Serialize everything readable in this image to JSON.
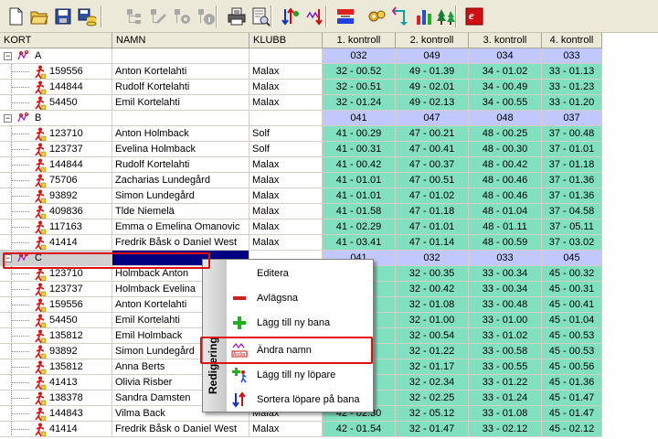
{
  "toolbar": {
    "buttons": [
      "new-icon",
      "open-icon",
      "save-icon",
      "save-db-icon",
      "tree-expand-icon",
      "tree-edit-icon",
      "tree-config-icon",
      "tree-info-icon",
      "print-icon",
      "print-preview-icon",
      "sort-runners-icon",
      "sort-controls-icon",
      "bank-transfer-icon",
      "gears-icon",
      "swap-icon",
      "bar-chart-icon",
      "trees-icon",
      "emit-icon"
    ],
    "emit_letter": "e"
  },
  "grid": {
    "columns": [
      "KORT",
      "NAMN",
      "KLUBB",
      "1. kontroll",
      "2. kontroll",
      "3. kontroll",
      "4. kontroll"
    ],
    "rows": [
      {
        "type": "group",
        "kort": "A",
        "controls": [
          "032",
          "049",
          "034",
          "033"
        ]
      },
      {
        "type": "runner",
        "kort": "159556",
        "namn": "Anton Kortelahti",
        "klubb": "Malax",
        "controls": [
          "32 - 00.52",
          "49 - 01.39",
          "34 - 01.02",
          "33 - 01.13"
        ]
      },
      {
        "type": "runner",
        "kort": "144844",
        "namn": "Rudolf Kortelahti",
        "klubb": "Malax",
        "controls": [
          "32 - 00.51",
          "49 - 02.01",
          "34 - 00.49",
          "33 - 01.23"
        ]
      },
      {
        "type": "runner",
        "kort": "54450",
        "namn": "Emil Kortelahti",
        "klubb": "Malax",
        "controls": [
          "32 - 01.24",
          "49 - 02.13",
          "34 - 00.55",
          "33 - 01.20"
        ]
      },
      {
        "type": "group",
        "kort": "B",
        "controls": [
          "041",
          "047",
          "048",
          "037"
        ]
      },
      {
        "type": "runner",
        "kort": "123710",
        "namn": "Anton Holmback",
        "klubb": "Solf",
        "controls": [
          "41 - 00.29",
          "47 - 00.21",
          "48 - 00.25",
          "37 - 00.48"
        ]
      },
      {
        "type": "runner",
        "kort": "123737",
        "namn": "Evelina Holmback",
        "klubb": "Solf",
        "controls": [
          "41 - 00.31",
          "47 - 00.41",
          "48 - 00.30",
          "37 - 01.01"
        ]
      },
      {
        "type": "runner",
        "kort": "144844",
        "namn": "Rudolf Kortelahti",
        "klubb": "Malax",
        "controls": [
          "41 - 00.42",
          "47 - 00.37",
          "48 - 00.42",
          "37 - 01.18"
        ]
      },
      {
        "type": "runner",
        "kort": "75706",
        "namn": "Zacharias Lundegård",
        "klubb": "Malax",
        "controls": [
          "41 - 01.01",
          "47 - 00.51",
          "48 - 00.46",
          "37 - 01.36"
        ]
      },
      {
        "type": "runner",
        "kort": "93892",
        "namn": "Simon Lundegård",
        "klubb": "Malax",
        "controls": [
          "41 - 01.01",
          "47 - 01.02",
          "48 - 00.46",
          "37 - 01.36"
        ]
      },
      {
        "type": "runner",
        "kort": "409836",
        "namn": "Tlde Niemelä",
        "klubb": "Malax",
        "controls": [
          "41 - 01.58",
          "47 - 01.18",
          "48 - 01.04",
          "37 - 04.58"
        ]
      },
      {
        "type": "runner",
        "kort": "117163",
        "namn": "Emma o Emelina Omanovic",
        "klubb": "Malax",
        "controls": [
          "41 - 02.29",
          "47 - 01.01",
          "48 - 01.11",
          "37 - 05.11"
        ]
      },
      {
        "type": "runner",
        "kort": "41414",
        "namn": "Fredrik Båsk o Daniel West",
        "klubb": "Malax",
        "controls": [
          "41 - 03.41",
          "47 - 01.14",
          "48 - 00.59",
          "37 - 03.02"
        ]
      },
      {
        "type": "group-selected",
        "kort": "C",
        "controls": [
          "041",
          "032",
          "033",
          "045"
        ]
      },
      {
        "type": "runner",
        "kort": "123710",
        "namn": "Holmback Anton",
        "klubb": "",
        "controls": [
          "",
          "32 - 00.35",
          "33 - 00.34",
          "45 - 00.32"
        ]
      },
      {
        "type": "runner",
        "kort": "123737",
        "namn": "Holmback Evelina",
        "klubb": "",
        "controls": [
          "",
          "32 - 00.42",
          "33 - 00.34",
          "45 - 00.31"
        ]
      },
      {
        "type": "runner",
        "kort": "159556",
        "namn": "Anton Kortelahti",
        "klubb": "",
        "controls": [
          "",
          "32 - 01.08",
          "33 - 00.48",
          "45 - 00.41"
        ]
      },
      {
        "type": "runner",
        "kort": "54450",
        "namn": "Emil Kortelahti",
        "klubb": "",
        "controls": [
          "",
          "32 - 01.00",
          "33 - 01.00",
          "45 - 01.04"
        ]
      },
      {
        "type": "runner",
        "kort": "135812",
        "namn": "Emil Holmback",
        "klubb": "",
        "controls": [
          "",
          "32 - 00.54",
          "33 - 01.02",
          "45 - 00.53"
        ]
      },
      {
        "type": "runner",
        "kort": "93892",
        "namn": "Simon Lundegård",
        "klubb": "",
        "controls": [
          "",
          "32 - 01.22",
          "33 - 00.58",
          "45 - 00.53"
        ]
      },
      {
        "type": "runner",
        "kort": "135812",
        "namn": "Anna Berts",
        "klubb": "",
        "controls": [
          "",
          "32 - 01.17",
          "33 - 00.55",
          "45 - 00.56"
        ]
      },
      {
        "type": "runner",
        "kort": "41413",
        "namn": "Olivia Risber",
        "klubb": "",
        "controls": [
          "",
          "32 - 02.34",
          "33 - 01.22",
          "45 - 01.36"
        ]
      },
      {
        "type": "runner",
        "kort": "138378",
        "namn": "Sandra Damsten",
        "klubb": "",
        "controls": [
          "",
          "32 - 02.25",
          "33 - 01.24",
          "45 - 01.47"
        ]
      },
      {
        "type": "runner",
        "kort": "144843",
        "namn": "Vilma Back",
        "klubb": "Malax",
        "controls": [
          "42 - 02.30",
          "32 - 05.12",
          "33 - 01.08",
          "45 - 01.47"
        ]
      },
      {
        "type": "runner",
        "kort": "41414",
        "namn": "Fredrik Båsk o Daniel West",
        "klubb": "Malax",
        "controls": [
          "42 - 01.54",
          "32 - 01.47",
          "33 - 02.12",
          "45 - 02.12"
        ]
      }
    ]
  },
  "context_menu": {
    "band_label": "Redigering",
    "items": [
      {
        "label": "Editera",
        "icon": "blank-icon"
      },
      {
        "label": "Avlägsna",
        "icon": "minus-icon"
      },
      {
        "label": "Lägg till ny bana",
        "icon": "plus-icon"
      },
      {
        "label": "Ändra namn",
        "icon": "rename-icon",
        "highlighted": true
      },
      {
        "label": "Lägg till ny löpare",
        "icon": "add-runner-icon"
      },
      {
        "label": "Sortera löpare på bana",
        "icon": "sort-icon"
      }
    ]
  },
  "colors": {
    "control_cell": "#80e0c0",
    "course_header_cell": "#c0c8ff",
    "selection": "#000080",
    "highlight_box": "#e01010"
  }
}
